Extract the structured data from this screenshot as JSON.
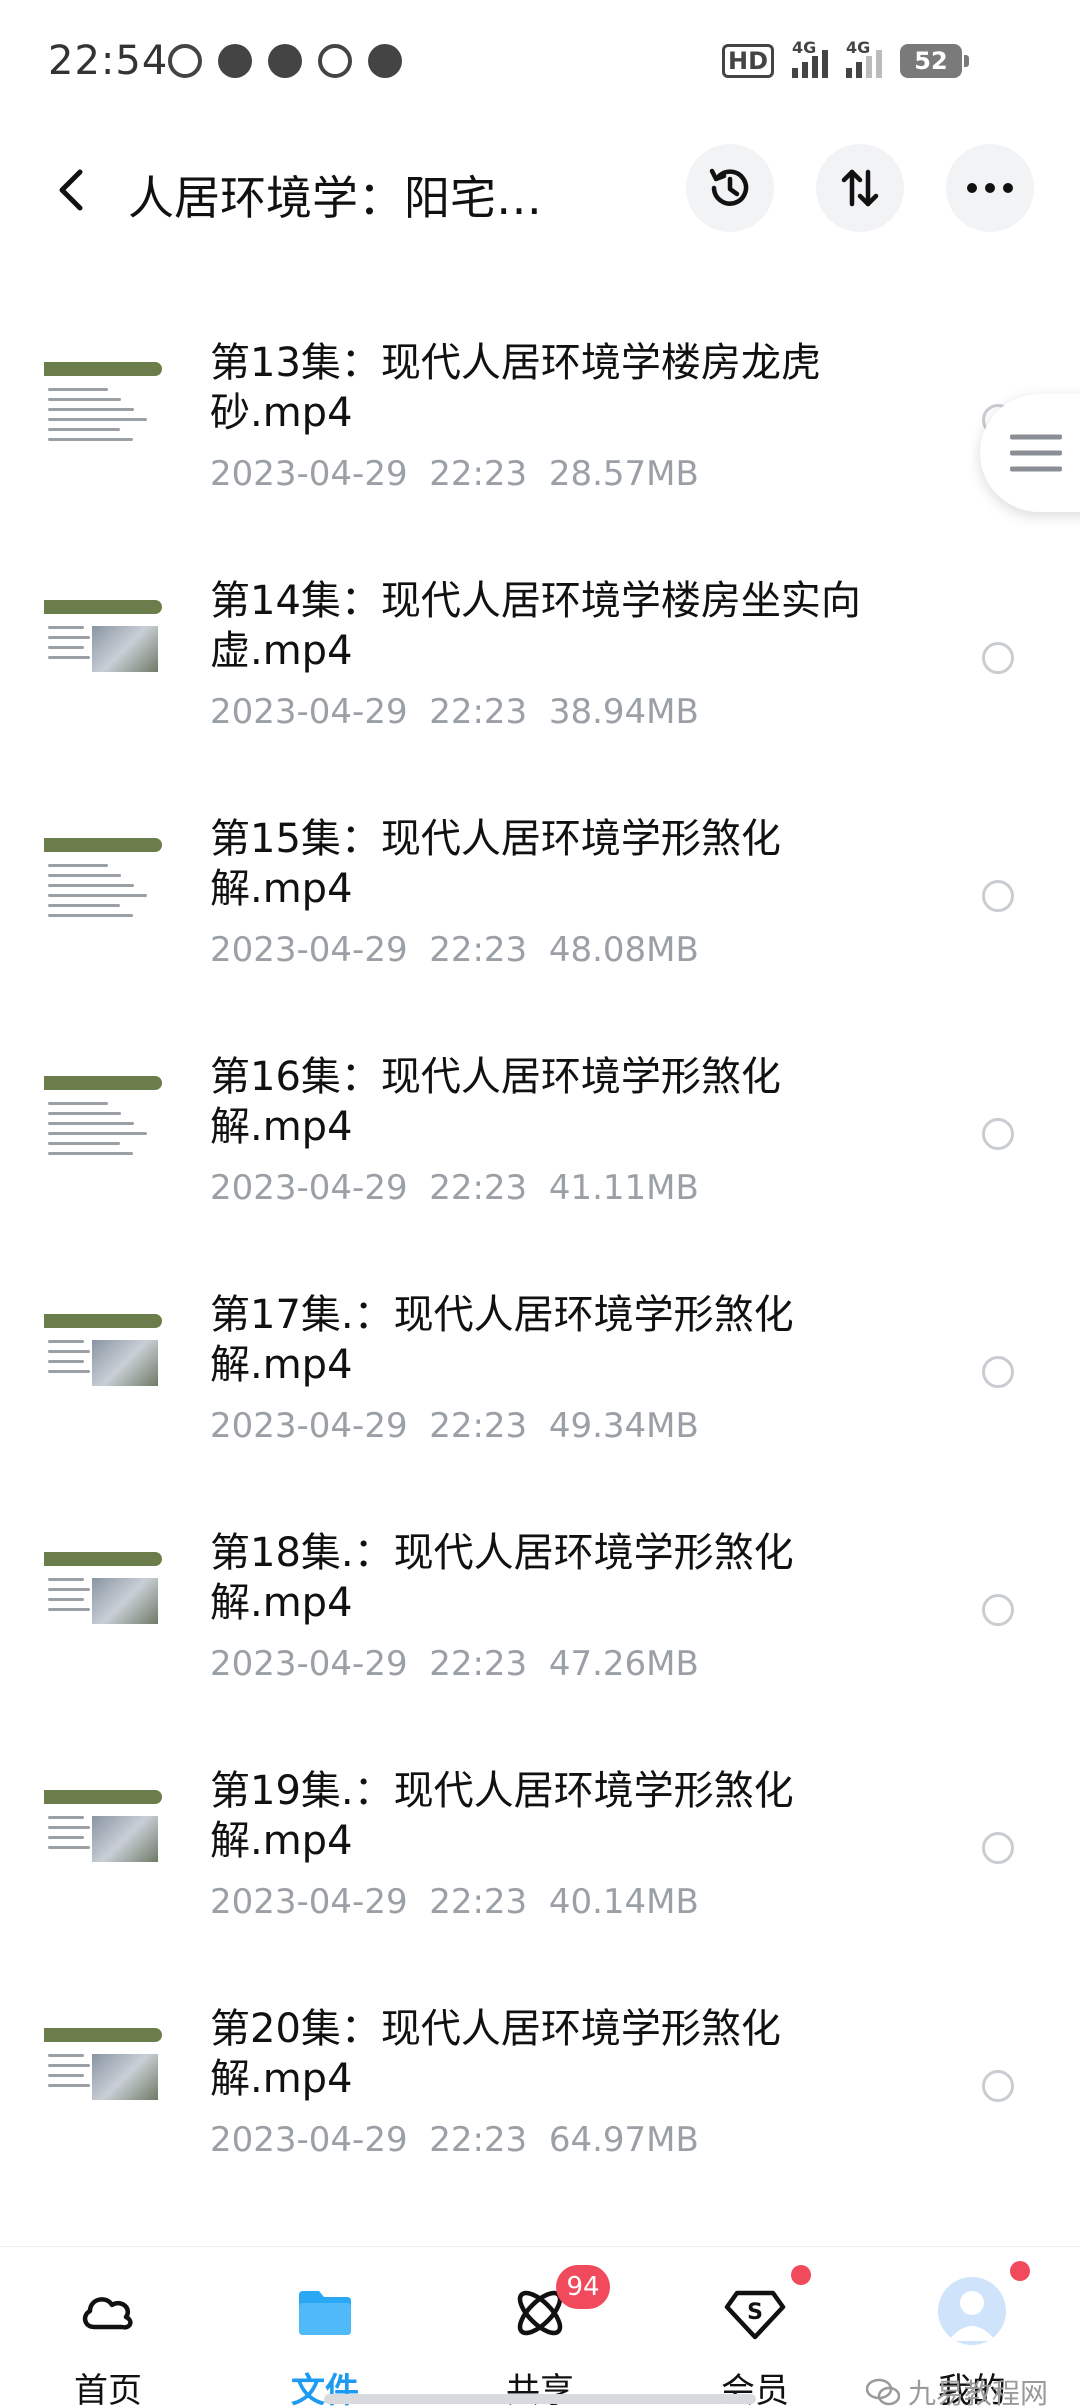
{
  "status_bar": {
    "time": "22:54",
    "hd_label": "HD",
    "network_1": "4G",
    "network_2": "4G",
    "battery": "52"
  },
  "header": {
    "title": "人居环境学：阳宅…",
    "history_icon": "history-icon",
    "sort_icon": "sort-icon",
    "more_icon": "more-icon"
  },
  "files": [
    {
      "title": "第13集：现代人居环境学楼房龙虎砂.mp4",
      "date": "2023-04-29  22:23",
      "size": "28.57MB",
      "thumb_has_pic": false
    },
    {
      "title": "第14集：现代人居环境学楼房坐实向虚.mp4",
      "date": "2023-04-29  22:23",
      "size": "38.94MB",
      "thumb_has_pic": true
    },
    {
      "title": "第15集：现代人居环境学形煞化解.mp4",
      "date": "2023-04-29  22:23",
      "size": "48.08MB",
      "thumb_has_pic": false
    },
    {
      "title": "第16集：现代人居环境学形煞化解.mp4",
      "date": "2023-04-29  22:23",
      "size": "41.11MB",
      "thumb_has_pic": false
    },
    {
      "title": "第17集.：现代人居环境学形煞化解.mp4",
      "date": "2023-04-29  22:23",
      "size": "49.34MB",
      "thumb_has_pic": true
    },
    {
      "title": "第18集.：现代人居环境学形煞化解.mp4",
      "date": "2023-04-29  22:23",
      "size": "47.26MB",
      "thumb_has_pic": true
    },
    {
      "title": "第19集.：现代人居环境学形煞化解.mp4",
      "date": "2023-04-29  22:23",
      "size": "40.14MB",
      "thumb_has_pic": true
    },
    {
      "title": "第20集：现代人居环境学形煞化解.mp4",
      "date": "2023-04-29  22:23",
      "size": "64.97MB",
      "thumb_has_pic": true
    }
  ],
  "bottom_nav": {
    "items": [
      {
        "label": "首页",
        "icon": "cloud-icon"
      },
      {
        "label": "文件",
        "icon": "folder-icon",
        "active": true
      },
      {
        "label": "共享",
        "icon": "share-atom-icon",
        "badge": "94"
      },
      {
        "label": "会员",
        "icon": "vip-diamond-icon"
      },
      {
        "label": "我的",
        "icon": "avatar-icon"
      }
    ]
  },
  "watermark": "九易教程网",
  "colors": {
    "accent": "#1e9bf0",
    "badge": "#f04a5c",
    "meta_text": "#9aa0a6",
    "thumb_bar": "#6b7d4a"
  }
}
